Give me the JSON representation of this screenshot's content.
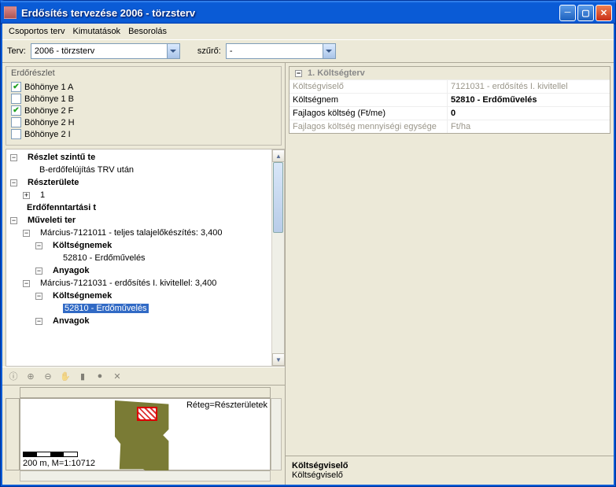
{
  "window": {
    "title": "Erdősítés tervezése 2006 - törzsterv"
  },
  "menu": {
    "m1": "Csoportos terv",
    "m2": "Kimutatások",
    "m3": "Besorolás"
  },
  "top": {
    "terv_label": "Terv:",
    "terv_value": "2006 - törzsterv",
    "szuro_label": "szűrő:",
    "szuro_value": "-"
  },
  "erdo": {
    "title": "Erdőrészlet",
    "items": [
      {
        "label": "Böhönye 1 A",
        "checked": true
      },
      {
        "label": "Böhönye 1 B",
        "checked": false
      },
      {
        "label": "Böhönye 2 F",
        "checked": true
      },
      {
        "label": "Böhönye 2 H",
        "checked": false
      },
      {
        "label": "Böhönye 2 I",
        "checked": false
      }
    ]
  },
  "tree": {
    "n0": "Részlet szintű te",
    "n0a": "B-erdőfelújítás TRV után",
    "n1": "Részterülete",
    "n1a": "1",
    "n2": "Erdőfenntartási t",
    "n3": "Műveleti ter",
    "n3a": "Március-7121011 - teljes talajelőkészítés: 3,400",
    "n3a1": "Költségnemek",
    "n3a1a": "52810 - Erdőművelés",
    "n3a2": "Anyagok",
    "n3b": "Március-7121031 - erdősítés I. kivitellel: 3,400",
    "n3b1": "Költségnemek",
    "n3b1a": "52810 - Erdőművelés",
    "n3b2": "Anvagok"
  },
  "map": {
    "layer": "Réteg=Részterületek",
    "scale": "200 m, M=1:10712"
  },
  "prop": {
    "header": "1. Költségterv",
    "r1k": "Költségviselő",
    "r1v": "7121031 - erdősítés I. kivitellel",
    "r2k": "Költségnem",
    "r2v": "52810 - Erdőművelés",
    "r3k": "Fajlagos költség (Ft/me)",
    "r3v": "0",
    "r4k": "Fajlagos költség mennyiségi egysége",
    "r4v": "Ft/ha"
  },
  "help": {
    "title": "Költségviselő",
    "desc": "Költségviselő"
  }
}
